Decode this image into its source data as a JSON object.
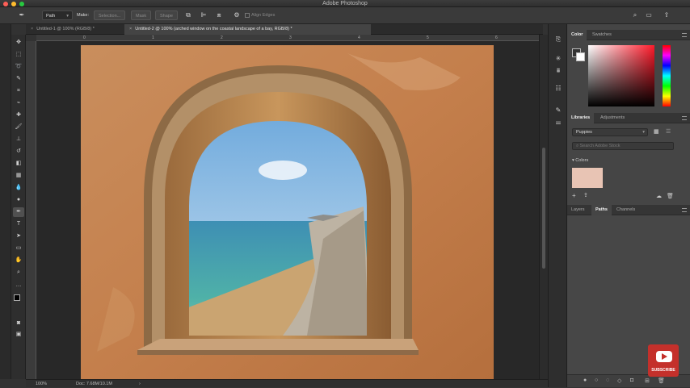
{
  "app": {
    "title": "Adobe Photoshop"
  },
  "options_bar": {
    "mode": "Path",
    "make_label": "Make:",
    "selection_label": "Selection...",
    "mask_label": "Mask",
    "shape_label": "Shape",
    "align_edges_label": "Align Edges"
  },
  "tabs": [
    {
      "label": "Untitled-1 @ 100% (RGB/8) *",
      "active": false
    },
    {
      "label": "Untitled-2 @ 100% (arched window on the coastal landscape of a bay, RGB/8) *",
      "active": true
    }
  ],
  "ruler": {
    "top": [
      "0",
      "1",
      "2",
      "3",
      "4",
      "5",
      "6"
    ]
  },
  "status": {
    "zoom": "100%",
    "doc_info": "Doc: 7.68M/10.1M"
  },
  "color_panel": {
    "tabs": [
      "Color",
      "Swatches"
    ],
    "accent": "#ff1a2a"
  },
  "libraries_panel": {
    "tabs": [
      "Libraries",
      "Adjustments"
    ],
    "library_name": "Puppies",
    "search_placeholder": "Search Adobe Stock",
    "group_label": "Colors",
    "swatch_color": "#e8c4b4"
  },
  "layers_panel": {
    "tabs": [
      "Layers",
      "Paths",
      "Channels"
    ]
  },
  "youtube": {
    "label": "SUBSCRIBE"
  }
}
